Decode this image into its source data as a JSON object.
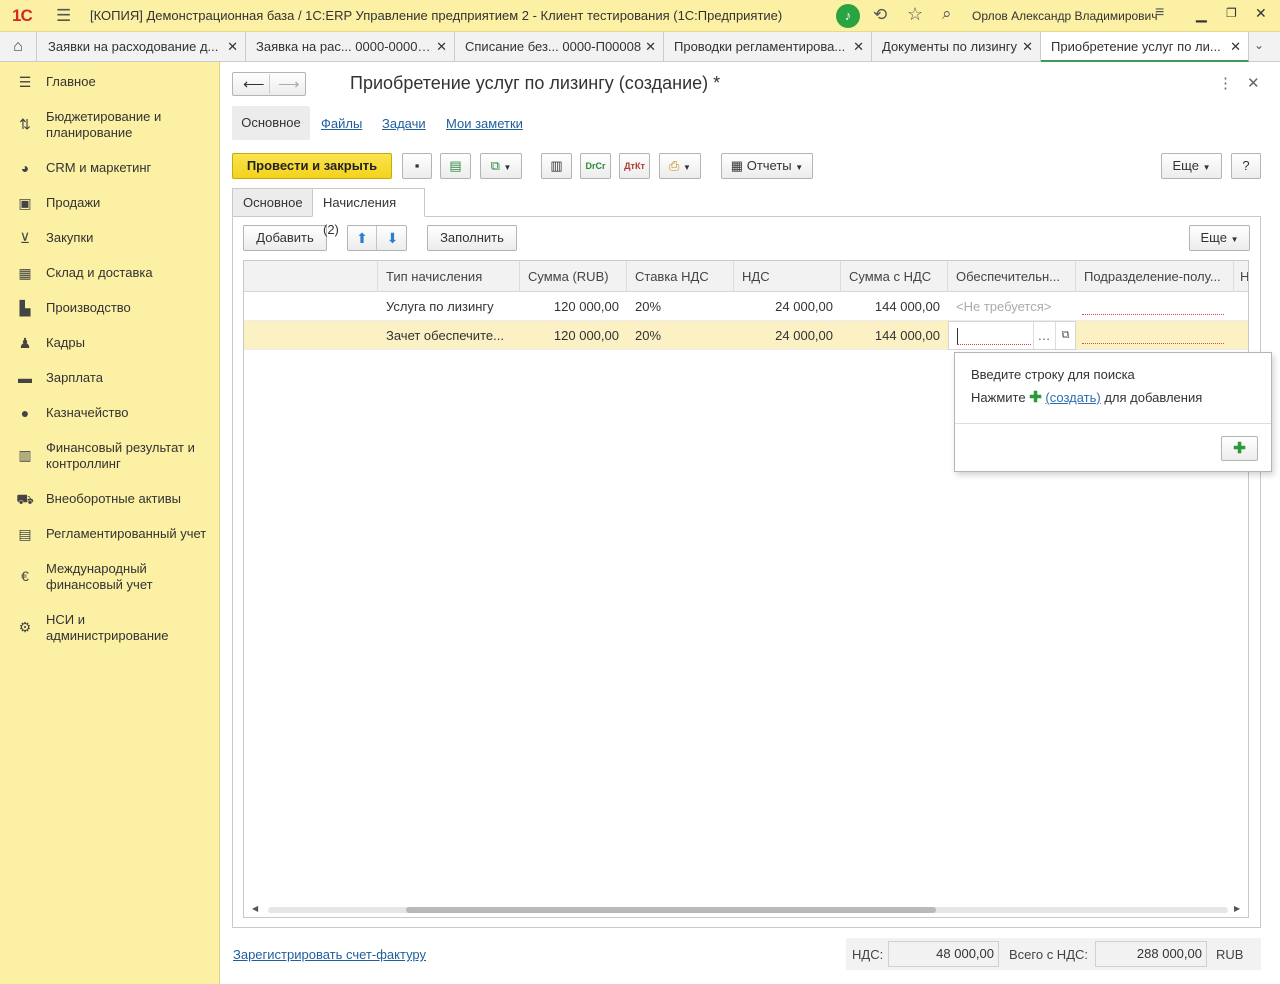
{
  "titlebar": {
    "logo": "1С",
    "title": "[КОПИЯ] Демонстрационная база / 1С:ERP Управление предприятием 2  - Клиент тестирования (1С:Предприятие)",
    "user": "Орлов Александр Владимирович"
  },
  "open_tabs": [
    {
      "label": "Заявки на расходование д..."
    },
    {
      "label": "Заявка на рас... 0000-000009"
    },
    {
      "label": "Списание без... 0000-П00008"
    },
    {
      "label": "Проводки регламентирова..."
    },
    {
      "label": "Документы по лизингу"
    },
    {
      "label": "Приобретение услуг по ли..."
    }
  ],
  "sidebar": {
    "items": [
      {
        "label": "Главное",
        "icon": "menu-lines-icon"
      },
      {
        "label": "Бюджетирование и планирование",
        "icon": "budget-chart-icon"
      },
      {
        "label": "CRM и маркетинг",
        "icon": "pie-chart-icon"
      },
      {
        "label": "Продажи",
        "icon": "bag-icon"
      },
      {
        "label": "Закупки",
        "icon": "cart-icon"
      },
      {
        "label": "Склад и доставка",
        "icon": "warehouse-grid-icon"
      },
      {
        "label": "Производство",
        "icon": "factory-icon"
      },
      {
        "label": "Кадры",
        "icon": "person-icon"
      },
      {
        "label": "Зарплата",
        "icon": "wallet-icon"
      },
      {
        "label": "Казначейство",
        "icon": "ruble-coin-icon"
      },
      {
        "label": "Финансовый результат и контроллинг",
        "icon": "bar-chart-icon"
      },
      {
        "label": "Внеоборотные активы",
        "icon": "assets-icon"
      },
      {
        "label": "Регламентированный учет",
        "icon": "calculator-icon"
      },
      {
        "label": "Международный финансовый учет",
        "icon": "euro-coin-icon"
      },
      {
        "label": "НСИ и администрирование",
        "icon": "gear-icon"
      }
    ]
  },
  "form": {
    "title": "Приобретение услуг по лизингу (создание) *",
    "nav": {
      "main": "Основное",
      "files": "Файлы",
      "tasks": "Задачи",
      "notes": "Мои заметки"
    },
    "toolbar": {
      "post_close": "Провести и закрыть",
      "reports": "Отчеты",
      "more": "Еще",
      "help": "?"
    },
    "tabs": [
      {
        "label": "Основное",
        "active": false
      },
      {
        "label": "Начисления (2)",
        "active": true
      }
    ],
    "table_toolbar": {
      "add": "Добавить",
      "fill": "Заполнить",
      "more": "Еще"
    },
    "columns": [
      "Тип начисления",
      "Сумма (RUB)",
      "Ставка НДС",
      "НДС",
      "Сумма с НДС",
      "Обеспечительн...",
      "Подразделение-полу...",
      "Н"
    ],
    "rows": [
      {
        "type": "Услуга по лизингу",
        "sum": "120 000,00",
        "rate": "20%",
        "vat": "24 000,00",
        "total": "144 000,00",
        "security": "<Не требуется>",
        "department": ""
      },
      {
        "type": "Зачет обеспечите...",
        "sum": "120 000,00",
        "rate": "20%",
        "vat": "24 000,00",
        "total": "144 000,00",
        "security": "",
        "department": ""
      }
    ],
    "popup": {
      "line1": "Введите строку для поиска",
      "line2_prefix": "Нажмите",
      "line2_link": "(создать)",
      "line2_suffix": "для добавления"
    },
    "footer": {
      "register_link": "Зарегистрировать счет-фактуру",
      "vat_label": "НДС:",
      "vat_value": "48 000,00",
      "total_label": "Всего с НДС:",
      "total_value": "288 000,00",
      "currency": "RUB"
    }
  },
  "colors": {
    "accent_yellow": "#f4d31b",
    "sidebar_bg": "#fbf0a4",
    "active_tab_line": "#3b9e56",
    "link": "#1f5e9e"
  }
}
